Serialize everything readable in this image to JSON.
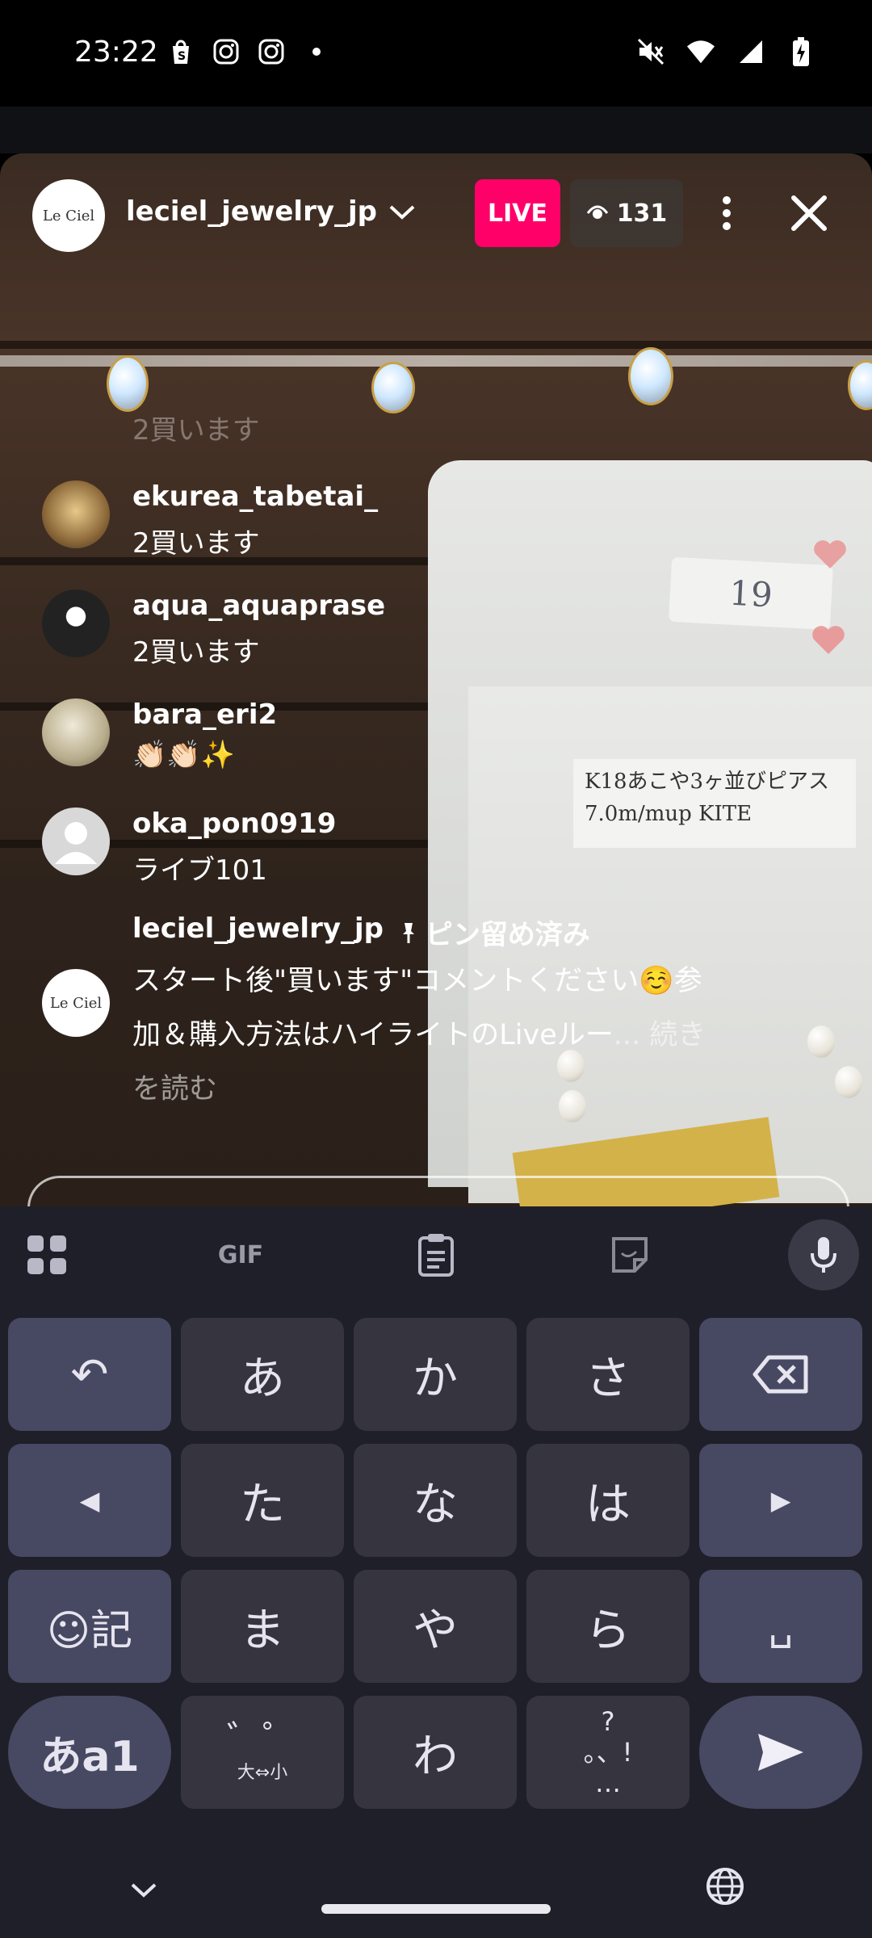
{
  "status_bar": {
    "time": "23:22",
    "left_icons": [
      "shopify-icon",
      "instagram-icon",
      "instagram-icon",
      "dot-icon"
    ],
    "right_icons": [
      "mute-icon",
      "wifi-icon",
      "signal-icon",
      "battery-charging-icon"
    ]
  },
  "live": {
    "host_avatar_text": "Le Ciel",
    "host_name": "leciel_jewelry_jp",
    "live_label": "LIVE",
    "viewer_count": "131",
    "product_tag": "19",
    "product_label_line1": "K18あこや3ヶ並びピアス",
    "product_label_line2": "7.0m/mup  KITE"
  },
  "comments": {
    "faded_text": "2買います",
    "items": [
      {
        "user": "ekurea_tabetai_",
        "text": "2買います",
        "avatar": "chandelier-avatar"
      },
      {
        "user": "aqua_aquaprase",
        "text": "2買います",
        "avatar": "penguin-avatar"
      },
      {
        "user": "bara_eri2",
        "text": "👏🏻👏🏻✨",
        "avatar": "photo-avatar"
      },
      {
        "user": "oka_pon0919",
        "text": "ライブ101",
        "avatar": "default-avatar"
      }
    ],
    "pinned": {
      "user": "leciel_jewelry_jp",
      "pin_label": "ピン留め済み",
      "line1": "スタート後\"買います\"コメントください☺️参",
      "line2": "加＆購入方法はハイライトのLiveルー",
      "more_inline": "... 続き",
      "line3": "を読む",
      "avatar_text": "Le Ciel"
    }
  },
  "keyboard": {
    "toolbar": {
      "gif_label": "GIF"
    },
    "row1": [
      "↶",
      "あ",
      "か",
      "さ"
    ],
    "row2": [
      "◀",
      "た",
      "な",
      "は",
      "▶"
    ],
    "row3": [
      "☺記",
      "ま",
      "や",
      "ら",
      "␣"
    ],
    "row4": {
      "mode": "あa1",
      "dakuten_top": "゛゜",
      "dakuten_bottom": "大⇔小",
      "wa": "わ",
      "punct_top": "?",
      "punct_mid": "。、!",
      "punct_bottom": "…"
    }
  },
  "nav": {
    "back_icon": "chevron-down-icon",
    "lang_icon": "globe-icon"
  }
}
